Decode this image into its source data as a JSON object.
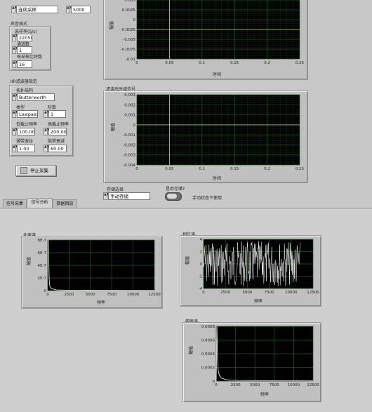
{
  "acquisition": {
    "mode_value": "连续采样",
    "sample_count_value": "5000",
    "format_group_label": "声音格式",
    "sample_rate_label": "采样率(S/s)",
    "sample_rate_value": "22050",
    "channels_label": "通道数",
    "channels_value": "1",
    "bits_label": "每采样比特数",
    "bits_value": "16"
  },
  "filter": {
    "group_label": "IIR滤波器规范",
    "topology_label": "拓扑结构",
    "topology_value": "Butterworth",
    "type_label": "类型",
    "type_value": "Lowpass",
    "order_label": "阶数",
    "order_value": "1",
    "low_cutoff_label": "低截止频率",
    "low_cutoff_value": "100.00",
    "high_cutoff_label": "高截止频率",
    "high_cutoff_value": "200.00",
    "passband_ripple_label": "通带波纹",
    "passband_ripple_value": "1.00",
    "stopband_atten_label": "阻带衰减",
    "stopband_atten_value": "60.00",
    "stop_button_label": "停止采集"
  },
  "graphs": {
    "raw": {
      "ylabel": "幅值",
      "xlabel": "时间",
      "y_ticks": [
        "0.005",
        "0.0025",
        "0",
        "-0.0025",
        "-0.005",
        "-0.0075",
        "-0.01"
      ],
      "x_ticks": [
        "0",
        "0.05",
        "0.1",
        "0.15",
        "0.2",
        "0.25"
      ]
    },
    "filtered": {
      "title": "滤波后时域信号",
      "ylabel": "幅值",
      "xlabel": "时间",
      "y_ticks": [
        "0.003",
        "0.002",
        "0.001",
        "0",
        "-0.001",
        "-0.002",
        "-0.003",
        "-0.004"
      ],
      "x_ticks": [
        "0",
        "0.05",
        "0.1",
        "0.15",
        "0.2",
        "0.25"
      ]
    }
  },
  "storage": {
    "select_label": "存储选择",
    "select_value": "手动存储",
    "save_question_label": "是否存储?",
    "manual_hint": "手动状态下使用"
  },
  "tabs": [
    {
      "label": "信号采集"
    },
    {
      "label": "信号分析"
    },
    {
      "label": "数据回放"
    }
  ],
  "analysis": {
    "power": {
      "title": "功率谱",
      "ylabel": "幅值",
      "xlabel": "频率",
      "y_ticks": [
        "8E-7",
        "6E-7",
        "4E-7",
        "2E-7",
        "0"
      ],
      "x_ticks": [
        "0",
        "2500",
        "5000",
        "7500",
        "10000",
        "12500"
      ]
    },
    "phase": {
      "title": "相位谱",
      "ylabel": "幅值",
      "xlabel": "频率",
      "y_ticks": [
        "4",
        "2",
        "0",
        "-2",
        "-4"
      ],
      "x_ticks": [
        "0",
        "2500",
        "5000",
        "7500",
        "10000",
        "12500"
      ]
    },
    "amplitude": {
      "title": "幅值谱",
      "ylabel": "幅值",
      "xlabel": "频率",
      "y_ticks": [
        "0.0008",
        "0.0006",
        "0.0004",
        "0.0002",
        "0"
      ],
      "x_ticks": [
        "0",
        "2500",
        "5000",
        "7500",
        "10000",
        "12500"
      ]
    }
  },
  "colors": {
    "plot_bg": "#000000",
    "grid": "#1e5a1e",
    "trace": "#ffffff",
    "cursor": "#c8d84a"
  }
}
